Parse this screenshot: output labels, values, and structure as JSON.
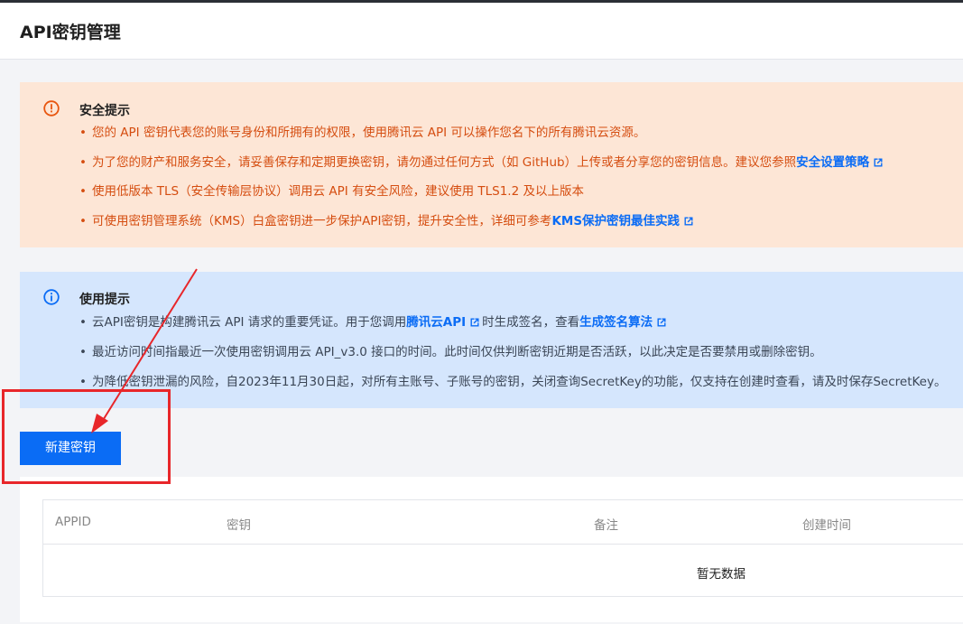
{
  "header": {
    "title": "API密钥管理"
  },
  "security_tip": {
    "title": "安全提示",
    "items": [
      {
        "text": "您的 API 密钥代表您的账号身份和所拥有的权限，使用腾讯云 API 可以操作您名下的所有腾讯云资源。"
      },
      {
        "text": "为了您的财产和服务安全，请妥善保存和定期更换密钥，请勿通过任何方式（如 GitHub）上传或者分享您的密钥信息。建议您参照",
        "link": "安全设置策略"
      },
      {
        "text": "使用低版本 TLS（安全传输层协议）调用云 API 有安全风险，建议使用 TLS1.2 及以上版本"
      },
      {
        "text": "可使用密钥管理系统（KMS）白盒密钥进一步保护API密钥，提升安全性，详细可参考",
        "link": "KMS保护密钥最佳实践"
      }
    ]
  },
  "usage_tip": {
    "title": "使用提示",
    "items": [
      {
        "before": "云API密钥是构建腾讯云 API 请求的重要凭证。用于您调用",
        "link1": "腾讯云API",
        "middle": "时生成签名，查看",
        "link2": "生成签名算法"
      },
      {
        "text": "最近访问时间指最近一次使用密钥调用云 API_v3.0 接口的时间。此时间仅供判断密钥近期是否活跃，以此决定是否要禁用或删除密钥。"
      },
      {
        "text": "为降低密钥泄漏的风险，自2023年11月30日起，对所有主账号、子账号的密钥，关闭查询SecretKey的功能，仅支持在创建时查看，请及时保存SecretKey。"
      }
    ]
  },
  "actions": {
    "new_key_label": "新建密钥"
  },
  "table": {
    "columns": [
      "APPID",
      "密钥",
      "备注",
      "创建时间"
    ],
    "empty_text": "暂无数据"
  },
  "colors": {
    "warning_bg": "#fde6d6",
    "warning_text": "#d54d10",
    "info_bg": "#d5e6fd",
    "link": "#0b6cf5",
    "primary_button": "#0a6cf5",
    "annotation": "#e8262a"
  },
  "icons": {
    "warning": "exclamation-circle-icon",
    "info": "info-circle-icon",
    "external_link": "external-link-icon"
  }
}
